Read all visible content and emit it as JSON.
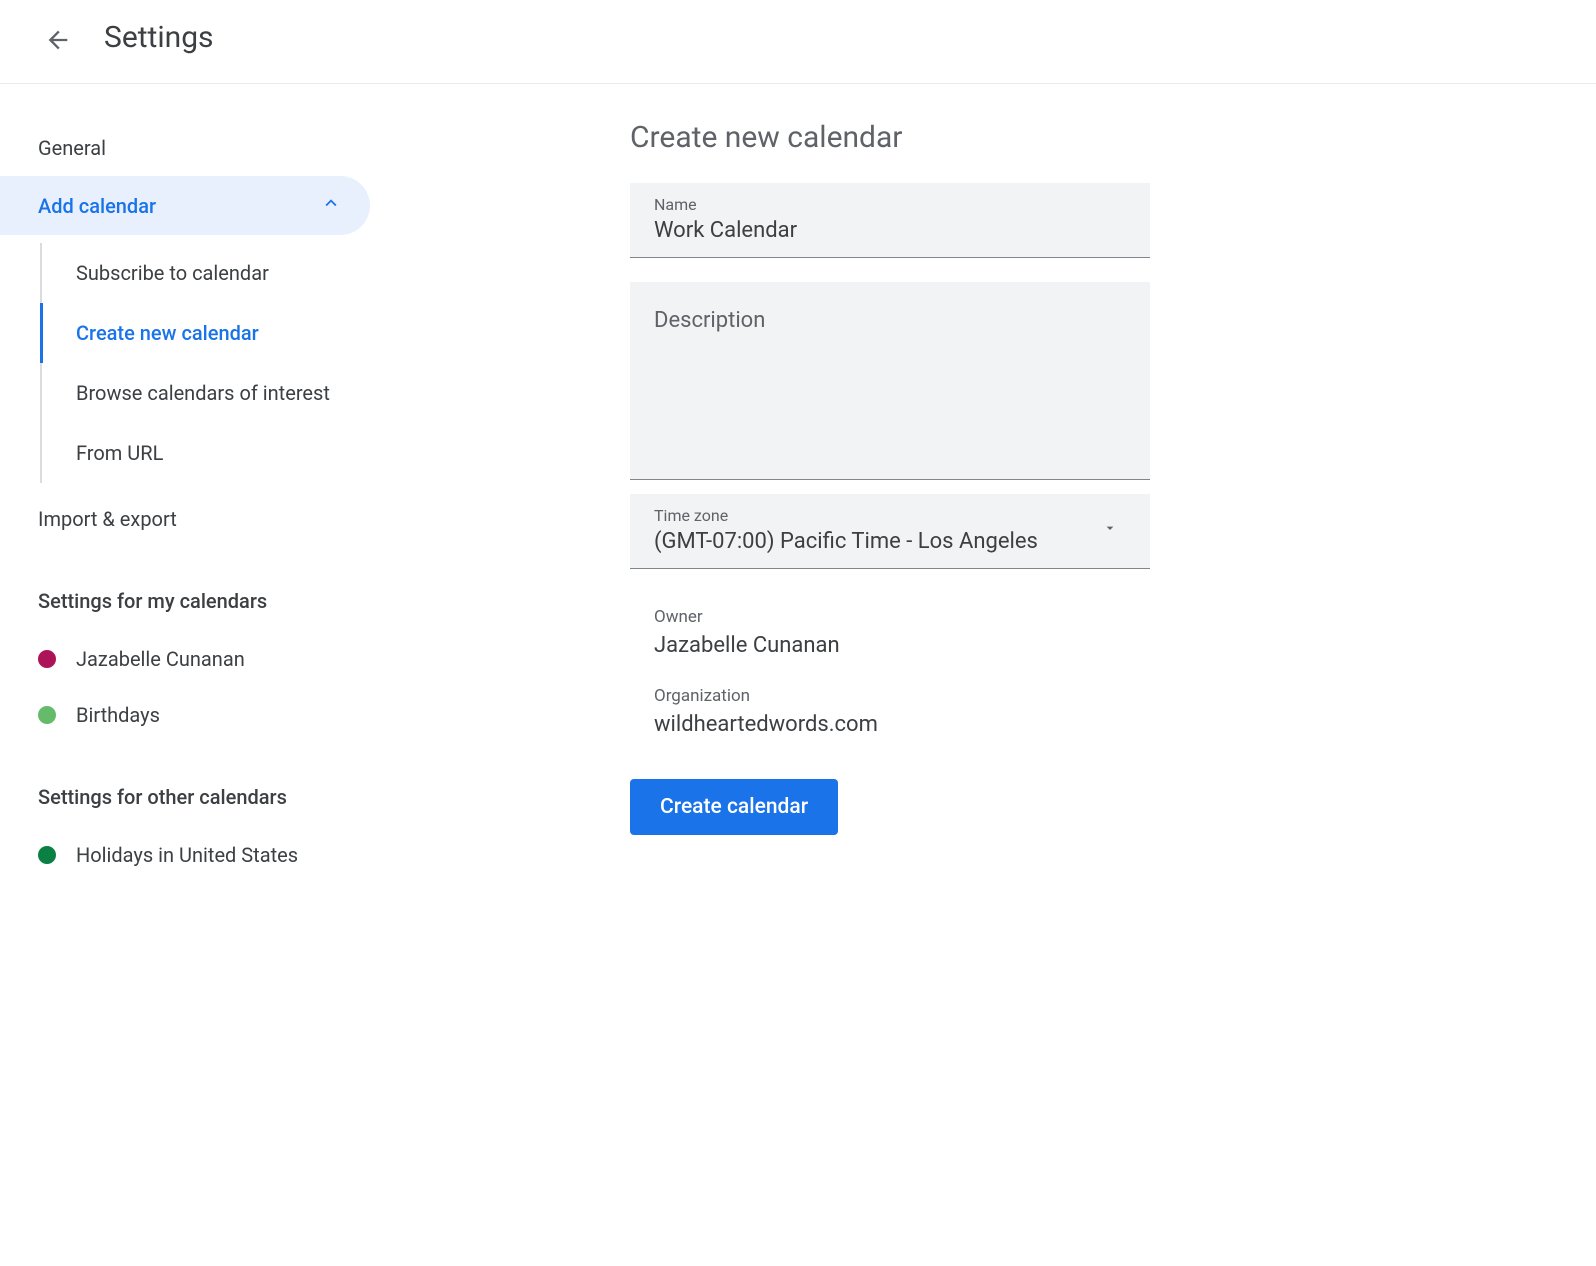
{
  "header": {
    "title": "Settings"
  },
  "sidebar": {
    "general": "General",
    "add_calendar": "Add calendar",
    "submenu": {
      "subscribe": "Subscribe to calendar",
      "create_new": "Create new calendar",
      "browse": "Browse calendars of interest",
      "from_url": "From URL"
    },
    "import_export": "Import & export",
    "my_calendars_header": "Settings for my calendars",
    "my_calendars": [
      {
        "label": "Jazabelle Cunanan",
        "color": "#ad1457"
      },
      {
        "label": "Birthdays",
        "color": "#66bb6a"
      }
    ],
    "other_calendars_header": "Settings for other calendars",
    "other_calendars": [
      {
        "label": "Holidays in United States",
        "color": "#0b8043"
      }
    ]
  },
  "main": {
    "title": "Create new calendar",
    "name_label": "Name",
    "name_value": "Work Calendar",
    "description_label": "Description",
    "timezone_label": "Time zone",
    "timezone_value": "(GMT-07:00) Pacific Time - Los Angeles",
    "owner_label": "Owner",
    "owner_value": "Jazabelle Cunanan",
    "organization_label": "Organization",
    "organization_value": "wildheartedwords.com",
    "create_button": "Create calendar"
  }
}
